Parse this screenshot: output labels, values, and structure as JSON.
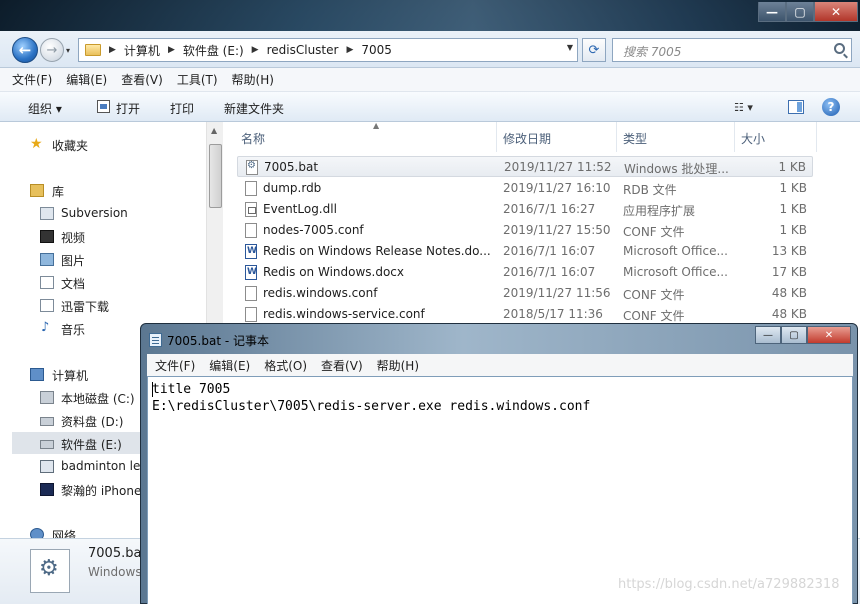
{
  "explorer": {
    "breadcrumb": [
      "计算机",
      "软件盘 (E:)",
      "redisCluster",
      "7005"
    ],
    "search_placeholder": "搜索 7005",
    "menu": [
      "文件(F)",
      "编辑(E)",
      "查看(V)",
      "工具(T)",
      "帮助(H)"
    ],
    "commands": {
      "organize": "组织 ▾",
      "open": "打开",
      "print": "打印",
      "new_folder": "新建文件夹"
    },
    "nav": {
      "favorites": "收藏夹",
      "libraries": "库",
      "library_items": [
        "Subversion",
        "视频",
        "图片",
        "文档",
        "迅雷下载",
        "音乐"
      ],
      "computer": "计算机",
      "drives": [
        "本地磁盘 (C:)",
        "资料盘 (D:)",
        "软件盘 (E:)",
        "badminton le",
        "黎瀚的 iPhone"
      ],
      "network": "网络"
    },
    "columns": {
      "name": "名称",
      "date": "修改日期",
      "type": "类型",
      "size": "大小"
    },
    "files": [
      {
        "name": "7005.bat",
        "date": "2019/11/27 11:52",
        "type": "Windows 批处理...",
        "size": "1 KB",
        "icon": "gear-icon"
      },
      {
        "name": "dump.rdb",
        "date": "2019/11/27 16:10",
        "type": "RDB 文件",
        "size": "1 KB",
        "icon": "file-icon"
      },
      {
        "name": "EventLog.dll",
        "date": "2016/7/1 16:27",
        "type": "应用程序扩展",
        "size": "1 KB",
        "icon": "dll-icon"
      },
      {
        "name": "nodes-7005.conf",
        "date": "2019/11/27 15:50",
        "type": "CONF 文件",
        "size": "1 KB",
        "icon": "file-icon"
      },
      {
        "name": "Redis on Windows Release Notes.do...",
        "date": "2016/7/1 16:07",
        "type": "Microsoft Office...",
        "size": "13 KB",
        "icon": "word-icon"
      },
      {
        "name": "Redis on Windows.docx",
        "date": "2016/7/1 16:07",
        "type": "Microsoft Office...",
        "size": "17 KB",
        "icon": "word-icon"
      },
      {
        "name": "redis.windows.conf",
        "date": "2019/11/27 11:56",
        "type": "CONF 文件",
        "size": "48 KB",
        "icon": "file-icon"
      },
      {
        "name": "redis.windows-service.conf",
        "date": "2018/5/17 11:36",
        "type": "CONF 文件",
        "size": "48 KB",
        "icon": "file-icon"
      }
    ],
    "details": {
      "name": "7005.bat",
      "type": "Windows"
    }
  },
  "notepad": {
    "title": "7005.bat - 记事本",
    "menu": [
      "文件(F)",
      "编辑(E)",
      "格式(O)",
      "查看(V)",
      "帮助(H)"
    ],
    "content": "title 7005\nE:\\redisCluster\\7005\\redis-server.exe redis.windows.conf"
  },
  "watermark": "https://blog.csdn.net/a729882318"
}
